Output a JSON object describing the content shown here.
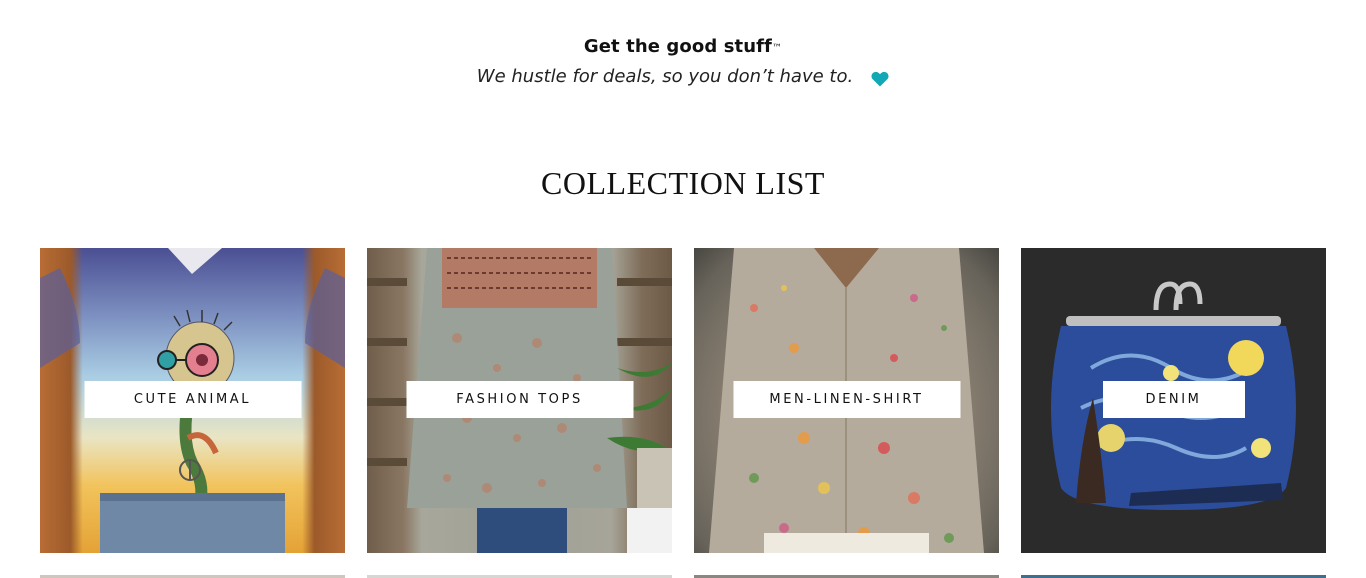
{
  "promo": {
    "title": "Get the good stuff",
    "trademark": "™",
    "subtitle": "We hustle for deals, so you don’t have to.",
    "heart_icon": "heart-icon",
    "heart_color": "#13a8b5"
  },
  "collection": {
    "heading": "COLLECTION LIST",
    "items": [
      {
        "label": "CUTE ANIMAL"
      },
      {
        "label": "FASHION TOPS"
      },
      {
        "label": "MEN-LINEN-SHIRT"
      },
      {
        "label": "DENIM"
      }
    ]
  }
}
